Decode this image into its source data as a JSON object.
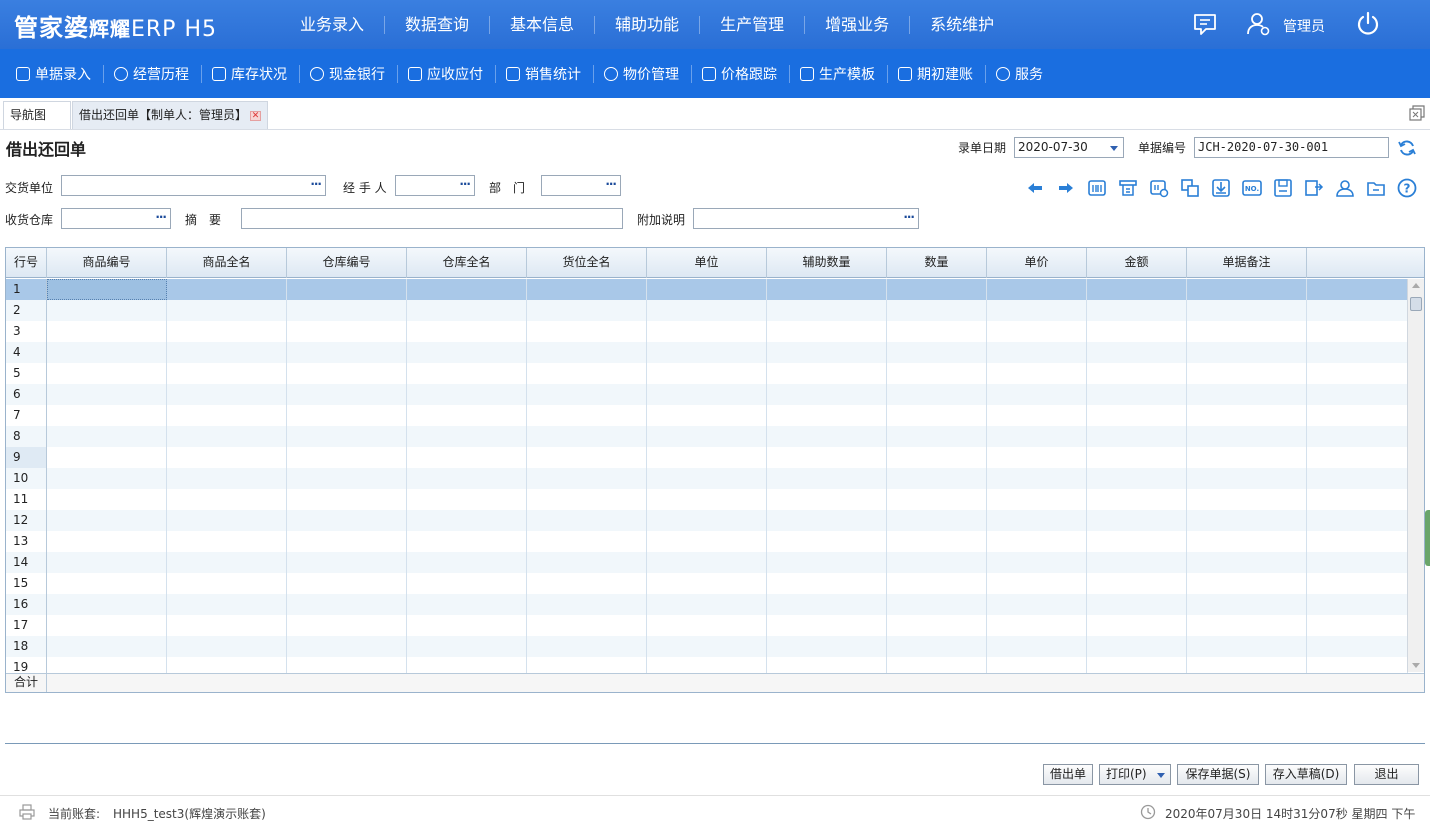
{
  "header": {
    "logo_main": "管家婆",
    "logo_sub": "辉耀",
    "logo_erp": "ERP H5",
    "nav": [
      "业务录入",
      "数据查询",
      "基本信息",
      "辅助功能",
      "生产管理",
      "增强业务",
      "系统维护"
    ],
    "user": "管理员",
    "icons": [
      "message-icon",
      "user-icon",
      "power-icon"
    ]
  },
  "toolbar": {
    "items": [
      "单据录入",
      "经营历程",
      "库存状况",
      "现金银行",
      "应收应付",
      "销售统计",
      "物价管理",
      "价格跟踪",
      "生产模板",
      "期初建账",
      "服务"
    ]
  },
  "tabs": {
    "nav": "导航图",
    "doc": "借出还回单【制单人：管理员】"
  },
  "form": {
    "title": "借出还回单",
    "date_label": "录单日期",
    "date_value": "2020-07-30",
    "number_label": "单据编号",
    "number_value": "JCH-2020-07-30-001",
    "supplier_label": "交货单位",
    "handler_label": "经 手 人",
    "dept_label": "部　门",
    "warehouse_label": "收货仓库",
    "summary_label": "摘　要",
    "note_label": "附加说明"
  },
  "grid": {
    "headers": [
      "行号",
      "商品编号",
      "商品全名",
      "仓库编号",
      "仓库全名",
      "货位全名",
      "单位",
      "辅助数量",
      "数量",
      "单价",
      "金额",
      "单据备注"
    ],
    "rows": [
      "1",
      "2",
      "3",
      "4",
      "5",
      "6",
      "7",
      "8",
      "9",
      "10",
      "11",
      "12",
      "13",
      "14",
      "15",
      "16",
      "17",
      "18",
      "19"
    ],
    "total_label": "合计"
  },
  "buttons": {
    "borrow": "借出单",
    "print": "打印(P)",
    "save": "保存单据(S)",
    "draft": "存入草稿(D)",
    "exit": "退出"
  },
  "status": {
    "account_label": "当前账套:",
    "account_value": "HHH5_test3(辉煌演示账套)",
    "datetime": "2020年07月30日 14时31分07秒 星期四 下午"
  },
  "colors": {
    "brand_blue": "#2a6fd6",
    "toolbar_blue": "#1a6ee0",
    "row_selected": "#a9c8e8",
    "row_alt": "#f1f7fb"
  }
}
